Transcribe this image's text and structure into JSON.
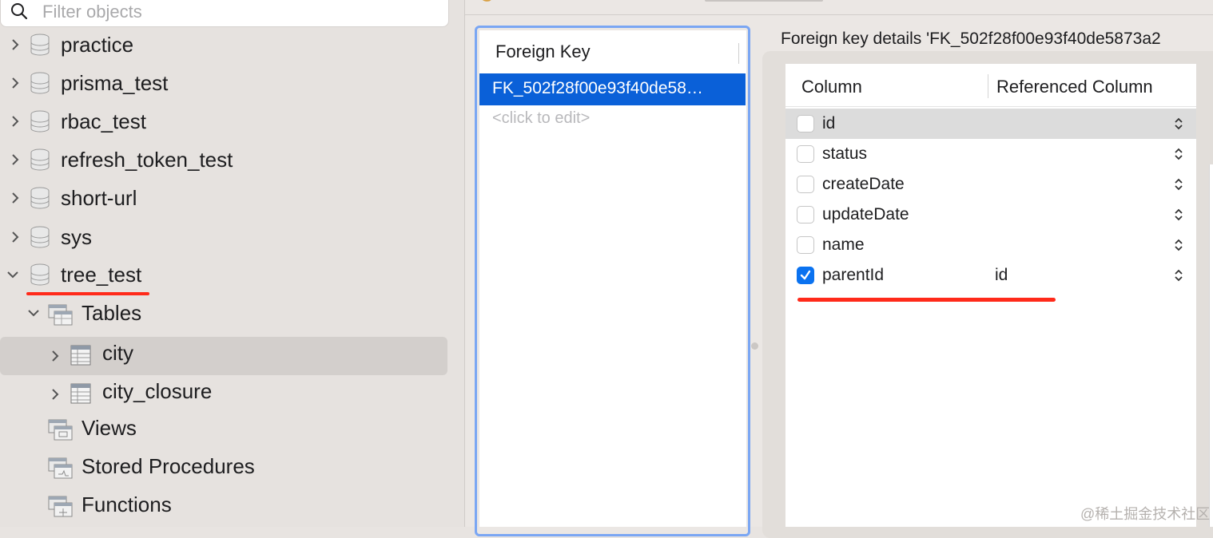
{
  "search": {
    "placeholder": "Filter objects",
    "value": ""
  },
  "sidebar": {
    "items": [
      {
        "label": "practice",
        "type": "database",
        "expanded": false
      },
      {
        "label": "prisma_test",
        "type": "database",
        "expanded": false
      },
      {
        "label": "rbac_test",
        "type": "database",
        "expanded": false
      },
      {
        "label": "refresh_token_test",
        "type": "database",
        "expanded": false
      },
      {
        "label": "short-url",
        "type": "database",
        "expanded": false
      },
      {
        "label": "sys",
        "type": "database",
        "expanded": false
      },
      {
        "label": "tree_test",
        "type": "database",
        "expanded": true
      },
      {
        "label": "Tables",
        "type": "folder",
        "expanded": true
      },
      {
        "label": "city",
        "type": "table",
        "selected": true
      },
      {
        "label": "city_closure",
        "type": "table"
      },
      {
        "label": "Views",
        "type": "folder"
      },
      {
        "label": "Stored Procedures",
        "type": "folder"
      },
      {
        "label": "Functions",
        "type": "folder"
      }
    ]
  },
  "foreign_keys": {
    "header": "Foreign Key",
    "items": [
      {
        "label": "FK_502f28f00e93f40de58…",
        "selected": true
      }
    ],
    "add_placeholder": "<click to edit>"
  },
  "details": {
    "title": "Foreign key details 'FK_502f28f00e93f40de5873a2",
    "headers": {
      "column": "Column",
      "referenced": "Referenced Column"
    },
    "rows": [
      {
        "column": "id",
        "checked": false,
        "referenced": ""
      },
      {
        "column": "status",
        "checked": false,
        "referenced": ""
      },
      {
        "column": "createDate",
        "checked": false,
        "referenced": ""
      },
      {
        "column": "updateDate",
        "checked": false,
        "referenced": ""
      },
      {
        "column": "name",
        "checked": false,
        "referenced": ""
      },
      {
        "column": "parentId",
        "checked": true,
        "referenced": "id"
      }
    ]
  },
  "watermark": "@稀土掘金技术社区",
  "colors": {
    "accent": "#0a60d8",
    "annotation": "#ff2a1a",
    "focus_ring": "#7aa6f3"
  },
  "icons": {
    "search": "search-icon",
    "chevron_right": "chevron-right-icon",
    "chevron_down": "chevron-down-icon",
    "database": "database-icon",
    "table": "table-icon",
    "folder": "folder-icon",
    "stepper": "stepper-icon"
  }
}
